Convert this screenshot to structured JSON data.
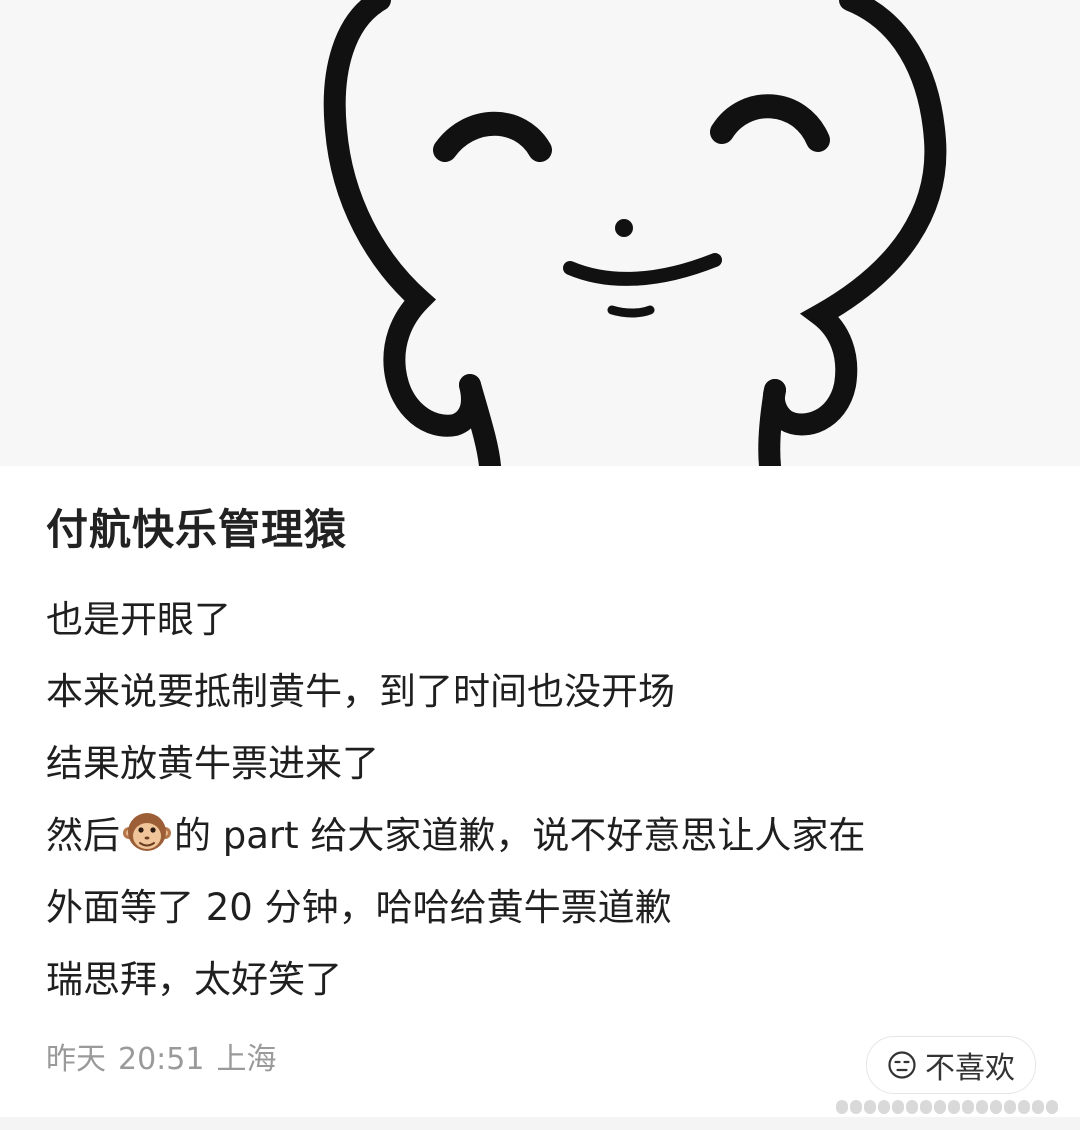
{
  "post": {
    "username": "付航快乐管理猿",
    "content": {
      "line1": "也是开眼了",
      "line2": "本来说要抵制黄牛，到了时间也没开场",
      "line3": "结果放黄牛票进来了",
      "line4_before_emoji": "然后",
      "line4_emoji": "monkey-face-emoji",
      "line4_after_emoji": "的 part 给大家道歉，说不好意思让人家在",
      "line5": "外面等了 20 分钟，哈哈给黄牛票道歉",
      "line6": "瑞思拜，太好笑了"
    },
    "meta": {
      "day": "昨天",
      "time": "20:51",
      "location": "上海"
    },
    "dislike_button": {
      "icon": "unamused-face-icon",
      "label": "不喜欢"
    }
  },
  "hero_image": {
    "icon": "smiling-round-face-sticker"
  },
  "colors": {
    "background": "#ffffff",
    "hero_background": "#f7f7f7",
    "text": "#1f1f1f",
    "meta_text": "#9a9a9a"
  }
}
